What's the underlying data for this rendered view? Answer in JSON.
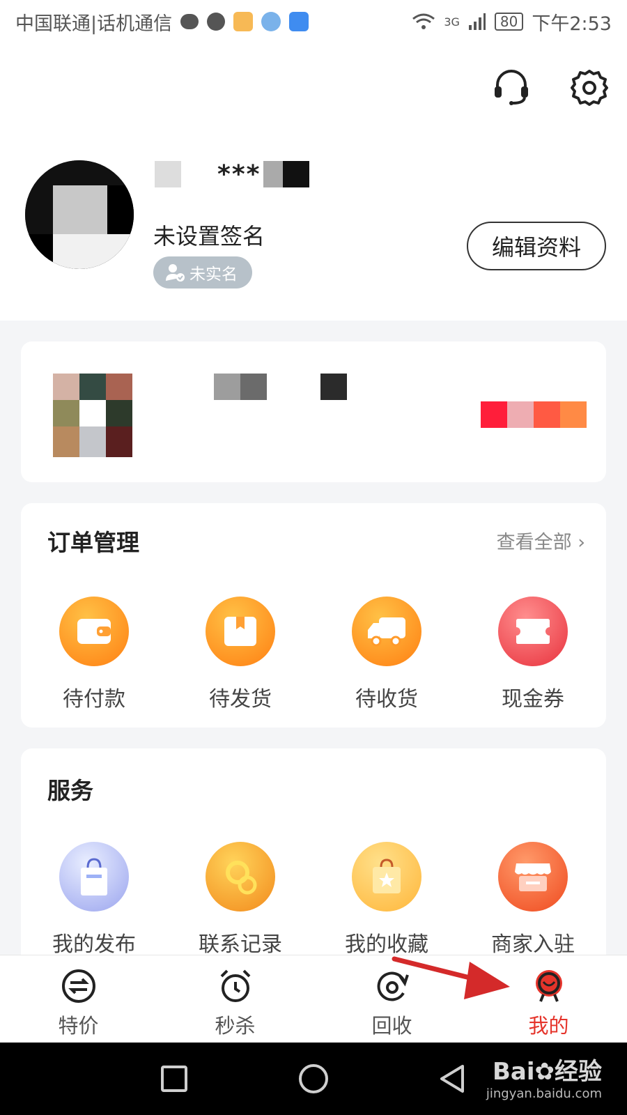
{
  "status_bar": {
    "carrier": "中国联通|话机通信",
    "network": "3G",
    "battery": "80",
    "time": "下午2:53"
  },
  "header": {
    "service_icon": "headset-icon",
    "settings_icon": "gear-icon"
  },
  "profile": {
    "name_masked": "***",
    "signature": "未设置签名",
    "verify_badge": "未实名",
    "edit_button": "编辑资料"
  },
  "orders": {
    "title": "订单管理",
    "view_all": "查看全部",
    "items": [
      {
        "label": "待付款",
        "icon": "wallet-icon"
      },
      {
        "label": "待发货",
        "icon": "box-icon"
      },
      {
        "label": "待收货",
        "icon": "truck-icon"
      },
      {
        "label": "现金券",
        "icon": "coupon-icon"
      }
    ]
  },
  "services": {
    "title": "服务",
    "items": [
      {
        "label": "我的发布",
        "icon": "shopping-bag-icon"
      },
      {
        "label": "联系记录",
        "icon": "magnifier-icon"
      },
      {
        "label": "我的收藏",
        "icon": "star-bag-icon"
      },
      {
        "label": "商家入驻",
        "icon": "storefront-icon"
      }
    ]
  },
  "tabbar": {
    "items": [
      {
        "label": "特价",
        "icon": "exchange-icon"
      },
      {
        "label": "秒杀",
        "icon": "alarm-clock-icon"
      },
      {
        "label": "回收",
        "icon": "recycle-icon"
      },
      {
        "label": "我的",
        "icon": "profile-icon"
      }
    ],
    "active_index": 3
  },
  "watermark": {
    "brand": "Bai",
    "brand2": "经验",
    "url": "jingyan.baidu.com"
  },
  "colors": {
    "accent": "#e5342b",
    "orange": "#ff8a1f",
    "annotation_arrow": "#d42a2a"
  }
}
